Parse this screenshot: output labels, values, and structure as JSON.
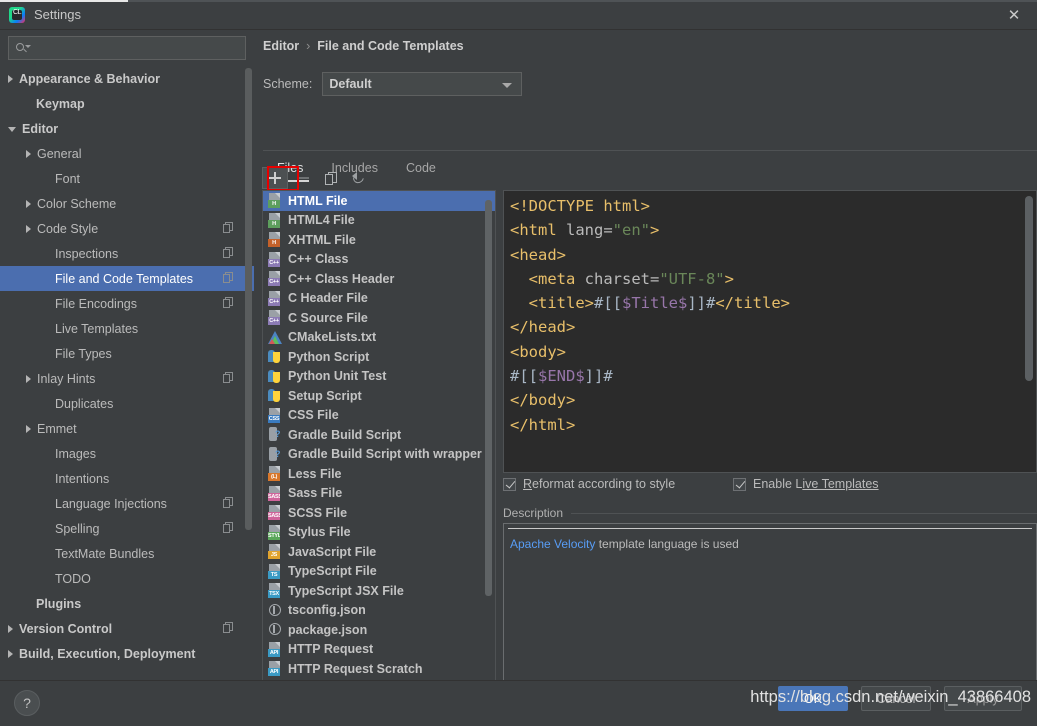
{
  "window": {
    "title": "Settings",
    "app_icon": "intellij-clion-icon",
    "close_label": "✕"
  },
  "search": {
    "value": "",
    "placeholder": "",
    "icon": "search-icon"
  },
  "sidebar": {
    "items": [
      {
        "label": "Appearance & Behavior",
        "indent": 8,
        "twisty": "closed",
        "bold": true,
        "copy": false,
        "selected": false
      },
      {
        "label": "Keymap",
        "indent": 25,
        "twisty": "none",
        "bold": true,
        "copy": false,
        "selected": false
      },
      {
        "label": "Editor",
        "indent": 8,
        "twisty": "open",
        "bold": true,
        "copy": false,
        "selected": false
      },
      {
        "label": "General",
        "indent": 26,
        "twisty": "closed",
        "bold": false,
        "copy": false,
        "selected": false
      },
      {
        "label": "Font",
        "indent": 44,
        "twisty": "none",
        "bold": false,
        "copy": false,
        "selected": false
      },
      {
        "label": "Color Scheme",
        "indent": 26,
        "twisty": "closed",
        "bold": false,
        "copy": false,
        "selected": false
      },
      {
        "label": "Code Style",
        "indent": 26,
        "twisty": "closed",
        "bold": false,
        "copy": true,
        "selected": false
      },
      {
        "label": "Inspections",
        "indent": 44,
        "twisty": "none",
        "bold": false,
        "copy": true,
        "selected": false
      },
      {
        "label": "File and Code Templates",
        "indent": 44,
        "twisty": "none",
        "bold": false,
        "copy": true,
        "selected": true
      },
      {
        "label": "File Encodings",
        "indent": 44,
        "twisty": "none",
        "bold": false,
        "copy": true,
        "selected": false
      },
      {
        "label": "Live Templates",
        "indent": 44,
        "twisty": "none",
        "bold": false,
        "copy": false,
        "selected": false
      },
      {
        "label": "File Types",
        "indent": 44,
        "twisty": "none",
        "bold": false,
        "copy": false,
        "selected": false
      },
      {
        "label": "Inlay Hints",
        "indent": 26,
        "twisty": "closed",
        "bold": false,
        "copy": true,
        "selected": false
      },
      {
        "label": "Duplicates",
        "indent": 44,
        "twisty": "none",
        "bold": false,
        "copy": false,
        "selected": false
      },
      {
        "label": "Emmet",
        "indent": 26,
        "twisty": "closed",
        "bold": false,
        "copy": false,
        "selected": false
      },
      {
        "label": "Images",
        "indent": 44,
        "twisty": "none",
        "bold": false,
        "copy": false,
        "selected": false
      },
      {
        "label": "Intentions",
        "indent": 44,
        "twisty": "none",
        "bold": false,
        "copy": false,
        "selected": false
      },
      {
        "label": "Language Injections",
        "indent": 44,
        "twisty": "none",
        "bold": false,
        "copy": true,
        "selected": false
      },
      {
        "label": "Spelling",
        "indent": 44,
        "twisty": "none",
        "bold": false,
        "copy": true,
        "selected": false
      },
      {
        "label": "TextMate Bundles",
        "indent": 44,
        "twisty": "none",
        "bold": false,
        "copy": false,
        "selected": false
      },
      {
        "label": "TODO",
        "indent": 44,
        "twisty": "none",
        "bold": false,
        "copy": false,
        "selected": false
      },
      {
        "label": "Plugins",
        "indent": 25,
        "twisty": "none",
        "bold": true,
        "copy": false,
        "selected": false
      },
      {
        "label": "Version Control",
        "indent": 8,
        "twisty": "closed",
        "bold": true,
        "copy": true,
        "selected": false
      },
      {
        "label": "Build, Execution, Deployment",
        "indent": 8,
        "twisty": "closed",
        "bold": true,
        "copy": false,
        "selected": false
      }
    ]
  },
  "breadcrumb": {
    "parent": "Editor",
    "separator": "›",
    "current": "File and Code Templates"
  },
  "scheme": {
    "label": "Scheme:",
    "value": "Default",
    "chevron_icon": "chevron-down-icon"
  },
  "tabs": [
    {
      "label": "Files",
      "active": true
    },
    {
      "label": "Includes",
      "active": false
    },
    {
      "label": "Code",
      "active": false
    }
  ],
  "list_toolbar": {
    "add": {
      "icon": "plus-icon",
      "label": "Add",
      "highlighted": true,
      "enabled": true
    },
    "remove": {
      "icon": "minus-icon",
      "label": "Remove",
      "highlighted": false,
      "enabled": false
    },
    "copy": {
      "icon": "copy-icon",
      "label": "Copy",
      "highlighted": false,
      "enabled": true
    },
    "reset": {
      "icon": "reset-icon",
      "label": "Reset",
      "highlighted": false,
      "enabled": true
    },
    "highlight_color": "#e60000"
  },
  "file_list": {
    "selected": "HTML File",
    "items": [
      {
        "label": "HTML File",
        "icon": "html-file-icon",
        "badge": "H",
        "badge_color": "#5d9e5d",
        "style": "page"
      },
      {
        "label": "HTML4 File",
        "icon": "html4-file-icon",
        "badge": "H",
        "badge_color": "#5d9e5d",
        "style": "page"
      },
      {
        "label": "XHTML File",
        "icon": "xhtml-file-icon",
        "badge": "H",
        "badge_color": "#c4612a",
        "style": "page"
      },
      {
        "label": "C++ Class",
        "icon": "cpp-class-icon",
        "badge": "C++",
        "badge_color": "#8c7bb5",
        "style": "page"
      },
      {
        "label": "C++ Class Header",
        "icon": "cpp-header-icon",
        "badge": "C++",
        "badge_color": "#8c7bb5",
        "style": "page"
      },
      {
        "label": "C Header File",
        "icon": "c-header-icon",
        "badge": "C++",
        "badge_color": "#8c7bb5",
        "style": "page"
      },
      {
        "label": "C Source File",
        "icon": "c-source-icon",
        "badge": "C++",
        "badge_color": "#8c7bb5",
        "style": "page"
      },
      {
        "label": "CMakeLists.txt",
        "icon": "cmake-icon",
        "badge": "",
        "badge_color": "#4c84c4",
        "style": "cmake"
      },
      {
        "label": "Python Script",
        "icon": "python-script-icon",
        "badge": "",
        "badge_color": "#4b8bbe",
        "style": "pyicon"
      },
      {
        "label": "Python Unit Test",
        "icon": "python-unittest-icon",
        "badge": "",
        "badge_color": "#4b8bbe",
        "style": "pyicon"
      },
      {
        "label": "Setup Script",
        "icon": "setup-script-icon",
        "badge": "",
        "badge_color": "#4b8bbe",
        "style": "pyicon"
      },
      {
        "label": "CSS File",
        "icon": "css-file-icon",
        "badge": "CSS",
        "badge_color": "#3a7bbf",
        "style": "page"
      },
      {
        "label": "Gradle Build Script",
        "icon": "gradle-icon",
        "badge": "",
        "badge_color": "#5a9bd8",
        "style": "gradle"
      },
      {
        "label": "Gradle Build Script with wrapper",
        "icon": "gradle-wrapper-icon",
        "badge": "",
        "badge_color": "#5a9bd8",
        "style": "gradle"
      },
      {
        "label": "Less File",
        "icon": "less-file-icon",
        "badge": "(L)",
        "badge_color": "#d8772b",
        "style": "page"
      },
      {
        "label": "Sass File",
        "icon": "sass-file-icon",
        "badge": "SASS",
        "badge_color": "#cf649a",
        "style": "page"
      },
      {
        "label": "SCSS File",
        "icon": "scss-file-icon",
        "badge": "SASS",
        "badge_color": "#cf649a",
        "style": "page"
      },
      {
        "label": "Stylus File",
        "icon": "stylus-file-icon",
        "badge": "STYL",
        "badge_color": "#5aa75a",
        "style": "page"
      },
      {
        "label": "JavaScript File",
        "icon": "javascript-file-icon",
        "badge": "JS",
        "badge_color": "#e0a32e",
        "style": "page"
      },
      {
        "label": "TypeScript File",
        "icon": "typescript-file-icon",
        "badge": "TS",
        "badge_color": "#3a9ac4",
        "style": "page"
      },
      {
        "label": "TypeScript JSX File",
        "icon": "tsx-file-icon",
        "badge": "TSX",
        "badge_color": "#3a9ac4",
        "style": "page"
      },
      {
        "label": "tsconfig.json",
        "icon": "tsconfig-json-icon",
        "badge": "",
        "badge_color": "#a5a9ad",
        "style": "jsonicon"
      },
      {
        "label": "package.json",
        "icon": "package-json-icon",
        "badge": "",
        "badge_color": "#a5a9ad",
        "style": "jsonicon"
      },
      {
        "label": "HTTP Request",
        "icon": "http-request-icon",
        "badge": "API",
        "badge_color": "#3a9ac4",
        "style": "page"
      },
      {
        "label": "HTTP Request Scratch",
        "icon": "http-scratch-icon",
        "badge": "API",
        "badge_color": "#3a9ac4",
        "style": "page"
      }
    ]
  },
  "editor": {
    "lines": [
      [
        {
          "t": "<!DOCTYPE html>",
          "c": "tk-tag"
        }
      ],
      [
        {
          "t": "<html ",
          "c": "tk-tag"
        },
        {
          "t": "lang=",
          "c": "tk-attr"
        },
        {
          "t": "\"en\"",
          "c": "tk-str"
        },
        {
          "t": ">",
          "c": "tk-tag"
        }
      ],
      [
        {
          "t": "<head>",
          "c": "tk-tag"
        }
      ],
      [
        {
          "t": "  <meta ",
          "c": "tk-tag"
        },
        {
          "t": "charset=",
          "c": "tk-attr"
        },
        {
          "t": "\"UTF-8\"",
          "c": "tk-str"
        },
        {
          "t": ">",
          "c": "tk-tag"
        }
      ],
      [
        {
          "t": "  <title>",
          "c": "tk-tag"
        },
        {
          "t": "#[[",
          "c": "tk-plain"
        },
        {
          "t": "$Title$",
          "c": "tk-var"
        },
        {
          "t": "]]#",
          "c": "tk-plain"
        },
        {
          "t": "</title>",
          "c": "tk-tag"
        }
      ],
      [
        {
          "t": "</head>",
          "c": "tk-tag"
        }
      ],
      [
        {
          "t": "<body>",
          "c": "tk-tag"
        }
      ],
      [
        {
          "t": "#[[",
          "c": "tk-plain"
        },
        {
          "t": "$END$",
          "c": "tk-var"
        },
        {
          "t": "]]#",
          "c": "tk-plain"
        }
      ],
      [
        {
          "t": "</body>",
          "c": "tk-tag"
        }
      ],
      [
        {
          "t": "</html>",
          "c": "tk-tag"
        }
      ]
    ]
  },
  "options": {
    "reformat": {
      "label_pre": "R",
      "label_post": "eformat according to style",
      "checked": true
    },
    "live_templates": {
      "label_pre": "Enable L",
      "label_post": "ive Templates",
      "checked": true
    }
  },
  "description": {
    "legend": "Description",
    "link_text": "Apache Velocity",
    "rest_text": " template language is used"
  },
  "footer": {
    "help_label": "?",
    "ok_label": "OK",
    "cancel_label": "Cancel",
    "apply_label": "Apply",
    "watermark": "https://blog.csdn.net/weixin_43866408"
  },
  "colors": {
    "accent": "#4b6eaf",
    "highlight_box": "#e60000",
    "background": "#3c3f41",
    "editor_background": "#2b2b2b",
    "ok_button": "#4a76b8"
  }
}
